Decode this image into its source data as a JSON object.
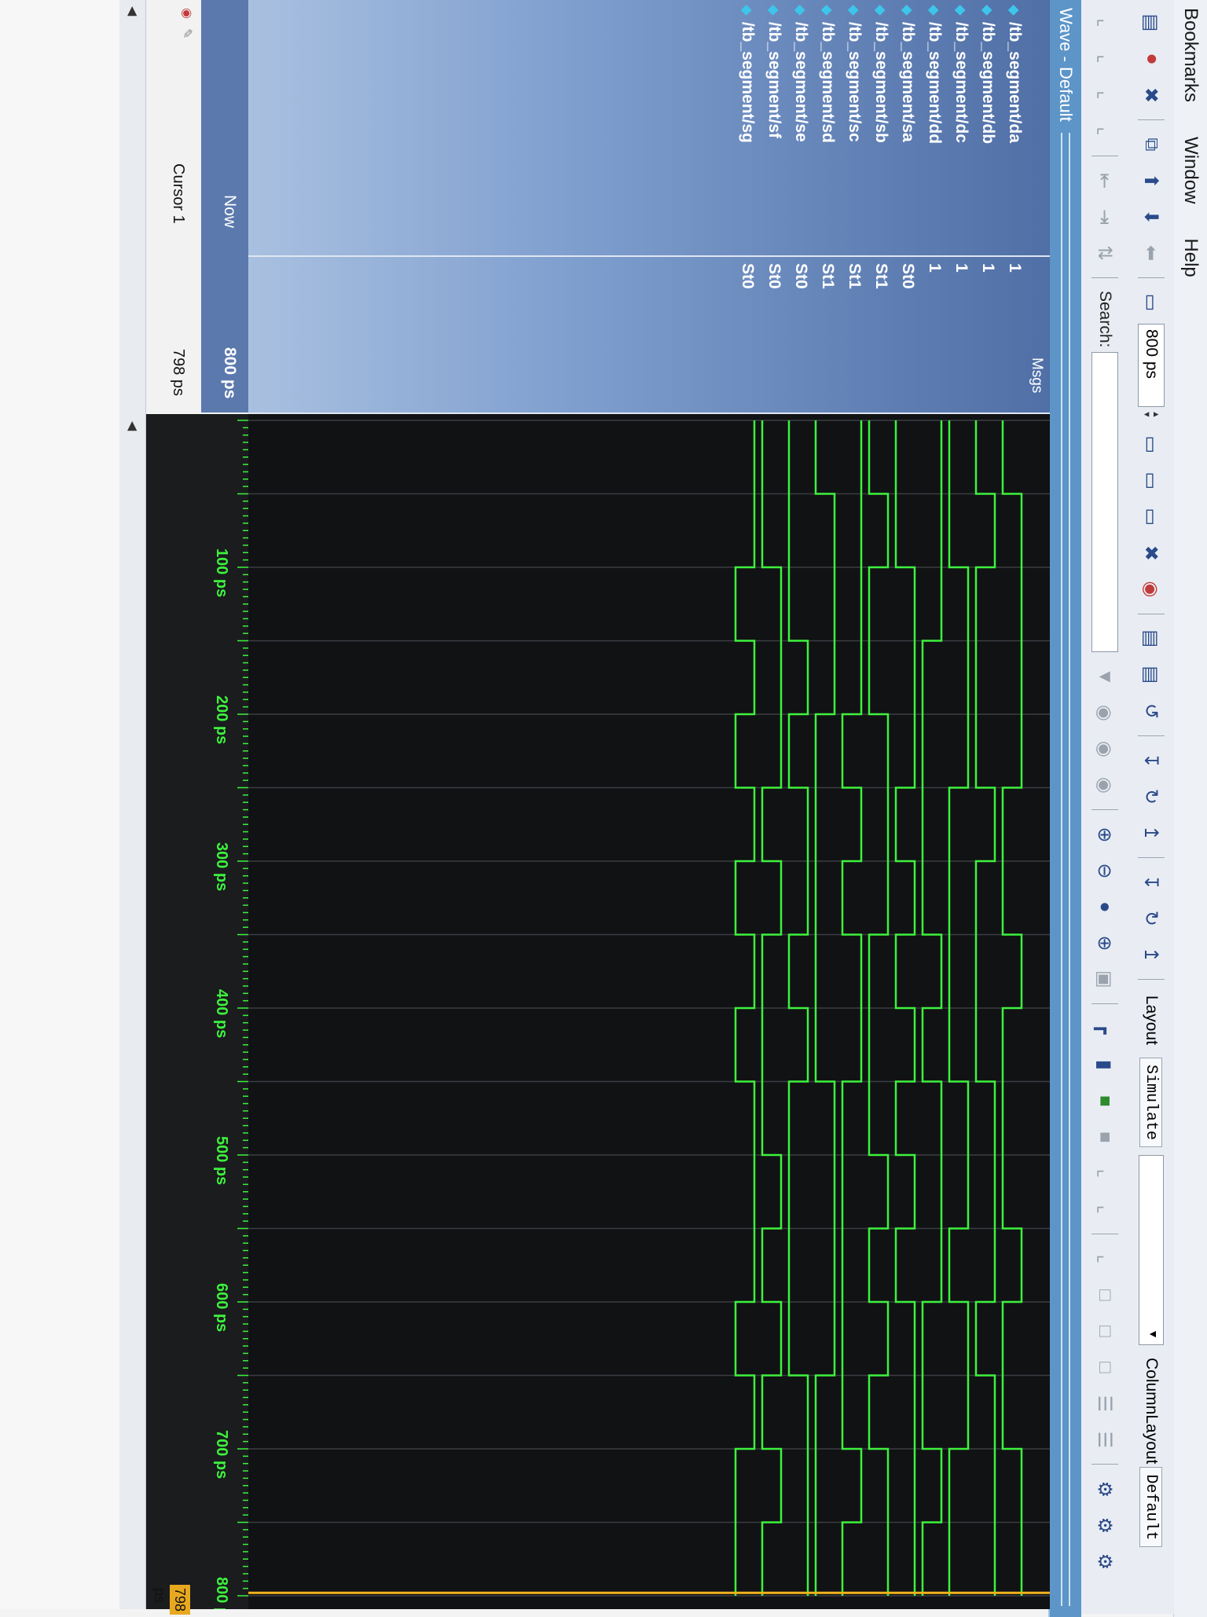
{
  "menu": {
    "items": [
      "Bookmarks",
      "Window",
      "Help"
    ]
  },
  "toolbar": {
    "time_value": "800 ps",
    "search_label": "Search:",
    "layout_tab": "Layout",
    "simulate_tab": "Simulate",
    "column_layout_label": "ColumnLayout",
    "default_tab": "Default"
  },
  "wave": {
    "title": "Wave - Default",
    "msgs_header": "Msgs",
    "signals": [
      {
        "name": "/tb_segment/da",
        "value": "1"
      },
      {
        "name": "/tb_segment/db",
        "value": "1"
      },
      {
        "name": "/tb_segment/dc",
        "value": "1"
      },
      {
        "name": "/tb_segment/dd",
        "value": "1"
      },
      {
        "name": "/tb_segment/sa",
        "value": "St0"
      },
      {
        "name": "/tb_segment/sb",
        "value": "St1"
      },
      {
        "name": "/tb_segment/sc",
        "value": "St1"
      },
      {
        "name": "/tb_segment/sd",
        "value": "St1"
      },
      {
        "name": "/tb_segment/se",
        "value": "St0"
      },
      {
        "name": "/tb_segment/sf",
        "value": "St0"
      },
      {
        "name": "/tb_segment/sg",
        "value": "St0"
      }
    ],
    "now_label": "Now",
    "now_value": "800 ps",
    "cursor_label": "Cursor 1",
    "cursor_value": "798 ps",
    "cursor_tag": "798 ps",
    "ruler_labels": [
      "100 ps",
      "200 ps",
      "300 ps",
      "400 ps",
      "500 ps",
      "600 ps",
      "700 ps",
      "800 ps"
    ]
  }
}
